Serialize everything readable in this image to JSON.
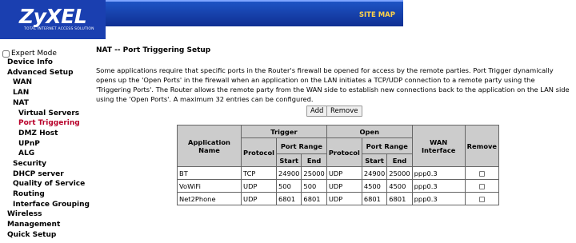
{
  "header": {
    "logo": "ZyXEL",
    "logo_sub": "TOTAL INTERNET ACCESS SOLUTION",
    "site_map": "SITE MAP",
    "colors": {
      "logo_bg": "#1a3fb0",
      "bar": "#1f56c8",
      "site_map": "#ffd24a"
    }
  },
  "sidebar": {
    "expert_mode": "Expert Mode",
    "items": [
      {
        "label": "Device Info"
      },
      {
        "label": "Advanced Setup"
      },
      {
        "label": "WAN"
      },
      {
        "label": "LAN"
      },
      {
        "label": "NAT"
      },
      {
        "label": "Virtual Servers"
      },
      {
        "label": "Port Triggering"
      },
      {
        "label": "DMZ Host"
      },
      {
        "label": "UPnP"
      },
      {
        "label": "ALG"
      },
      {
        "label": "Security"
      },
      {
        "label": "DHCP server"
      },
      {
        "label": "Quality of Service"
      },
      {
        "label": "Routing"
      },
      {
        "label": "Interface Grouping"
      },
      {
        "label": "Wireless"
      },
      {
        "label": "Management"
      },
      {
        "label": "Quick Setup"
      }
    ],
    "active_color": "#b8002a"
  },
  "main": {
    "title": "NAT -- Port Triggering Setup",
    "description": "Some applications require that specific ports in the Router's firewall be opened for access by the remote parties. Port Trigger dynamically opens up the 'Open Ports' in the firewall when an application on the LAN initiates a TCP/UDP connection to a remote party using the 'Triggering Ports'. The Router allows the remote party from the WAN side to establish new connections back to the application on the LAN side using the 'Open Ports'. A maximum 32 entries can be configured.",
    "add_label": "Add",
    "remove_label": "Remove"
  },
  "table": {
    "headers": {
      "app_name": "Application Name",
      "trigger": "Trigger",
      "open": "Open",
      "protocol": "Protocol",
      "port_range": "Port Range",
      "start": "Start",
      "end": "End",
      "wan_interface": "WAN Interface",
      "remove": "Remove"
    },
    "rows": [
      {
        "app": "BT",
        "t_proto": "TCP",
        "t_start": "24900",
        "t_end": "25000",
        "o_proto": "UDP",
        "o_start": "24900",
        "o_end": "25000",
        "wan": "ppp0.3"
      },
      {
        "app": "VoWiFi",
        "t_proto": "UDP",
        "t_start": "500",
        "t_end": "500",
        "o_proto": "UDP",
        "o_start": "4500",
        "o_end": "4500",
        "wan": "ppp0.3"
      },
      {
        "app": "Net2Phone",
        "t_proto": "UDP",
        "t_start": "6801",
        "t_end": "6801",
        "o_proto": "UDP",
        "o_start": "6801",
        "o_end": "6801",
        "wan": "ppp0.3"
      }
    ]
  }
}
